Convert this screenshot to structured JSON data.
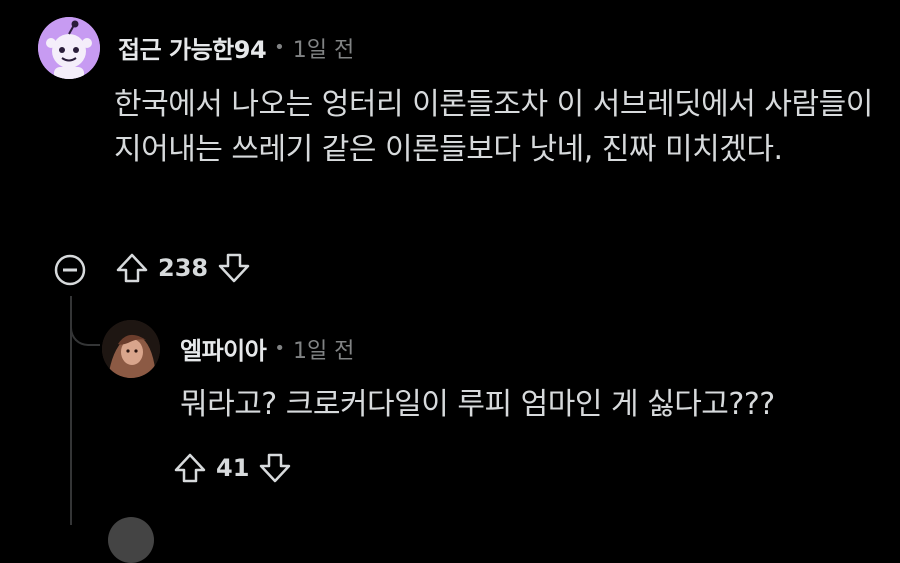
{
  "comment": {
    "username": "접근 가능한94",
    "separator": "•",
    "time": "1일 전",
    "body": "한국에서 나오는 엉터리 이론들조차 이 서브레딧에서 사람들이 지어내는 쓰레기 같은 이론들보다 낫네, 진짜 미치겠다.",
    "vote_count": "238",
    "avatar_icon": "snoo-avatar-icon",
    "avatar_color": "#c79bf2"
  },
  "reply": {
    "username": "엘파이아",
    "separator": "•",
    "time": "1일 전",
    "body": "뭐라고? 크로커다일이 루피 엄마인 게 싫다고???",
    "vote_count": "41",
    "avatar_icon": "anime-character-avatar-icon"
  },
  "icons": {
    "collapse": "minus-circle-icon",
    "upvote": "arrow-up-icon",
    "downvote": "arrow-down-icon"
  }
}
